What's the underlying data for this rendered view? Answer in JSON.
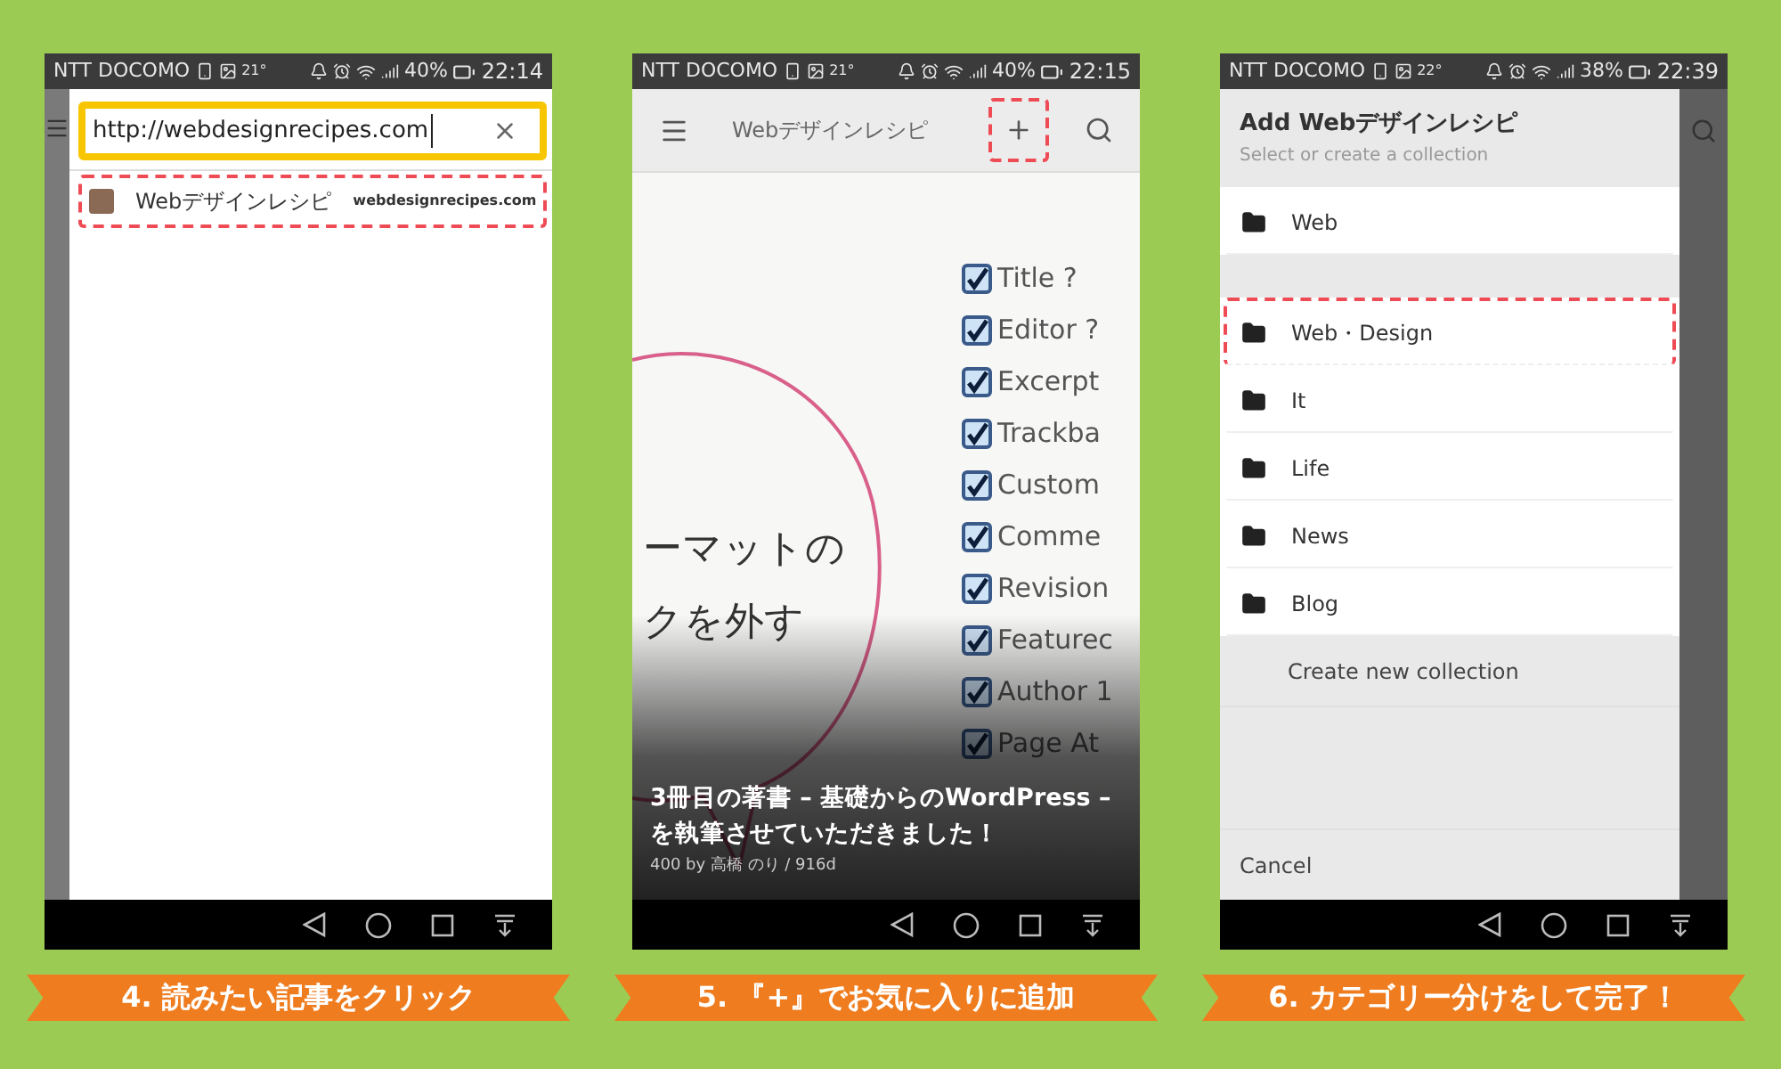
{
  "screens": [
    {
      "kind": "browser",
      "status": {
        "carrier": "NTT DOCOMO",
        "temp": "21°",
        "battery": "40%",
        "time": "22:14"
      },
      "search": {
        "value": "http://webdesignrecipes.com"
      },
      "suggestions": [
        {
          "title": "Webデザインレシピ",
          "url": "webdesignrecipes.com",
          "highlighted": true
        }
      ],
      "caption": "4. 読みたい記事をクリック"
    },
    {
      "kind": "article",
      "status": {
        "carrier": "NTT DOCOMO",
        "temp": "21°",
        "battery": "40%",
        "time": "22:15"
      },
      "app_bar": {
        "title": "Webデザインレシピ",
        "add_highlighted": true
      },
      "thumbnail": {
        "lines": [
          "ーマットの",
          "クを外す"
        ],
        "checklist": [
          {
            "label": "Title ?",
            "checked": true
          },
          {
            "label": "Editor ?",
            "checked": true
          },
          {
            "label": "Excerpt",
            "checked": true
          },
          {
            "label": "Trackba",
            "checked": true
          },
          {
            "label": "Custom",
            "checked": true
          },
          {
            "label": "Comme",
            "checked": true
          },
          {
            "label": "Revision",
            "checked": true
          },
          {
            "label": "Featurec",
            "checked": true
          },
          {
            "label": "Author 1",
            "checked": true
          },
          {
            "label": "Page At",
            "checked": true
          }
        ]
      },
      "article": {
        "title": "3冊目の著書 – 基礎からのWordPress – を執筆させていただきました！",
        "meta": "400 by 高橋 のり / 916d"
      },
      "caption": "5. 『+』でお気に入りに追加"
    },
    {
      "kind": "collection",
      "status": {
        "carrier": "NTT DOCOMO",
        "temp": "22°",
        "battery": "38%",
        "time": "22:39"
      },
      "dialog": {
        "title": "Add Webデザインレシピ",
        "subtitle": "Select or create a collection",
        "groups": [
          {
            "items": [
              {
                "name": "Web",
                "highlighted": false
              }
            ]
          },
          {
            "items": [
              {
                "name": "Web・Design",
                "highlighted": true
              },
              {
                "name": "It",
                "highlighted": false
              },
              {
                "name": "Life",
                "highlighted": false
              },
              {
                "name": "News",
                "highlighted": false
              },
              {
                "name": "Blog",
                "highlighted": false
              }
            ]
          }
        ],
        "create_label": "Create new collection",
        "cancel_label": "Cancel"
      },
      "caption": "6. カテゴリー分けをして完了！"
    }
  ]
}
